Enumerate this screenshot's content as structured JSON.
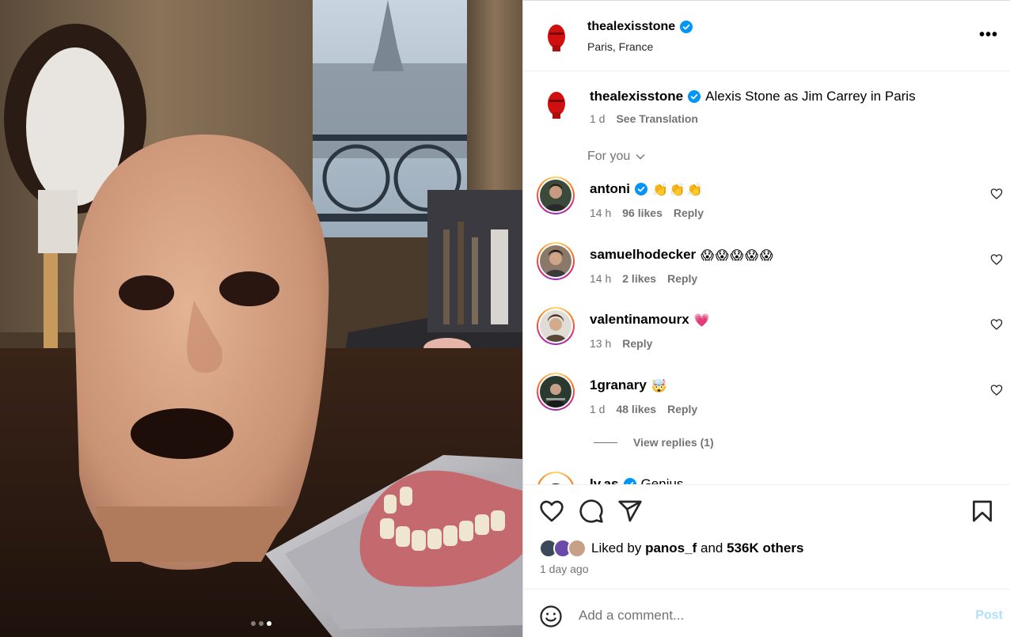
{
  "media": {
    "carousel_dots": 3,
    "active_dot_index": 2
  },
  "header": {
    "username": "thealexisstone",
    "verified": true,
    "location": "Paris, France",
    "more_icon": "more-horizontal-icon"
  },
  "caption": {
    "username": "thealexisstone",
    "text": "Alexis Stone as Jim Carrey in Paris",
    "time": "1 d",
    "see_translation": "See Translation"
  },
  "for_you": {
    "label": "For you"
  },
  "comments": [
    {
      "username": "antoni",
      "verified": true,
      "text": "👏👏👏",
      "time": "14 h",
      "likes": "96 likes",
      "reply": "Reply"
    },
    {
      "username": "samuelhodecker",
      "verified": false,
      "text": "😱😱😱😱😱",
      "time": "14 h",
      "likes": "2 likes",
      "reply": "Reply"
    },
    {
      "username": "valentinamourx",
      "verified": false,
      "text": "💗",
      "time": "13 h",
      "likes": "",
      "reply": "Reply"
    },
    {
      "username": "1granary",
      "verified": false,
      "text": "🤯",
      "time": "1 d",
      "likes": "48 likes",
      "reply": "Reply"
    },
    {
      "username": "lv.as",
      "verified": true,
      "text": "Genius",
      "time": "",
      "likes": "",
      "reply": ""
    }
  ],
  "view_replies": "View replies (1)",
  "likes": {
    "prefix": "Liked by",
    "user": "panos_f",
    "connector": "and",
    "others": "536K others"
  },
  "posted": "1 day ago",
  "add_comment": {
    "placeholder": "Add a comment...",
    "post_label": "Post"
  },
  "colors": {
    "verified_blue": "#0095f6",
    "muted_text": "#737373",
    "post_disabled": "#b2dffc",
    "heart_red": "#e4405f"
  }
}
